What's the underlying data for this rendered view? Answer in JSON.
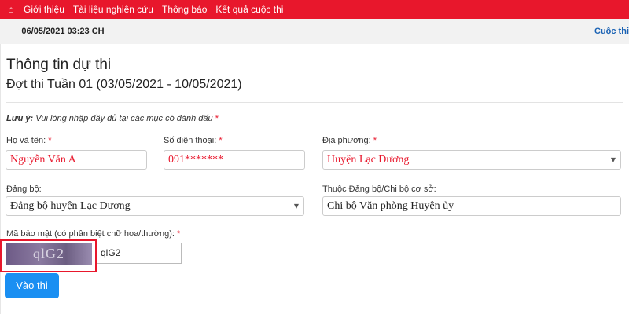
{
  "nav": {
    "home_icon": "⌂",
    "links": [
      "Giới thiệu",
      "Tài liệu nghiên cứu",
      "Thông báo",
      "Kết quả cuộc thi"
    ]
  },
  "timebar": {
    "datetime": "06/05/2021 03:23 CH",
    "contests_link": "Cuộc thi"
  },
  "form": {
    "title": "Thông tin dự thi",
    "subtitle": "Đợt thi Tuần 01 (03/05/2021 - 10/05/2021)",
    "note_label": "Lưu ý:",
    "note_text": " Vui lòng nhập đầy đủ tại các mục có đánh dấu ",
    "required_mark": "*",
    "fullname": {
      "label": "Họ và tên:",
      "value": "Nguyễn Văn A"
    },
    "phone": {
      "label": "Số điện thoại:",
      "value": "091*******"
    },
    "locality": {
      "label": "Địa phương:",
      "value": "Huyện Lạc Dương"
    },
    "party": {
      "label": "Đảng bộ:",
      "value": "Đảng bộ huyện Lạc Dương"
    },
    "branch": {
      "label": "Thuộc Đảng bộ/Chi bộ cơ sở:",
      "value": "Chi bộ Văn phòng Huyện ủy"
    },
    "captcha": {
      "label": "Mã bảo mật (có phân biệt chữ hoa/thường):",
      "image_text": "qlG2",
      "value": "qlG2"
    },
    "submit_label": "Vào thi"
  },
  "colors": {
    "nav_bg": "#e8172c",
    "button_bg": "#1a8ff2",
    "link": "#1a62b4",
    "required": "#e8172c"
  }
}
